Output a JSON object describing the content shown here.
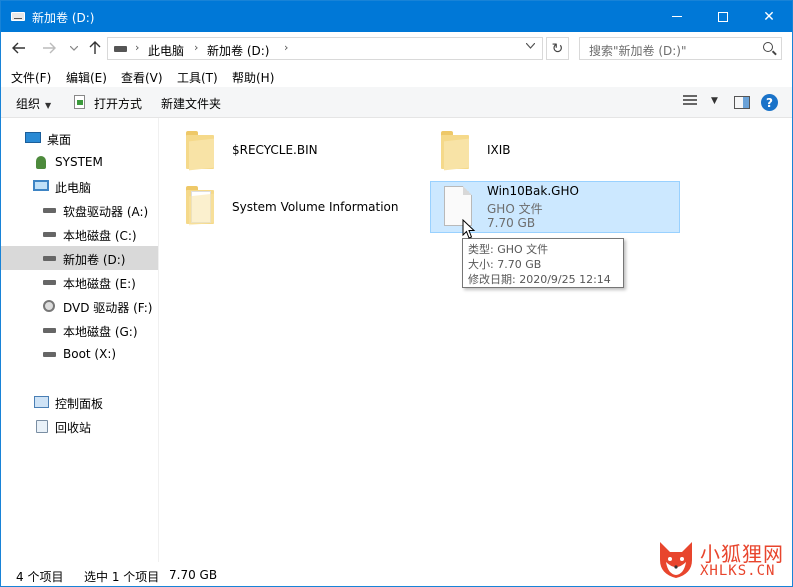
{
  "window": {
    "title": "新加卷 (D:)",
    "accent_color": "#0078d7"
  },
  "titlebar_buttons": {
    "minimize_icon": "minimize-icon",
    "maximize_icon": "maximize-icon",
    "close_glyph": "✕"
  },
  "address_bar": {
    "breadcrumbs": [
      "此电脑",
      "新加卷 (D:)"
    ],
    "separator": "›",
    "refresh_glyph": "↻",
    "search_placeholder": "搜索\"新加卷 (D:)\""
  },
  "menu": [
    "文件(F)",
    "编辑(E)",
    "查看(V)",
    "工具(T)",
    "帮助(H)"
  ],
  "toolbar": {
    "organize": "组织",
    "open_with": "打开方式",
    "new_folder": "新建文件夹",
    "help_glyph": "?"
  },
  "sidebar": {
    "items": [
      {
        "label": "桌面",
        "icon": "desktop-icon"
      },
      {
        "label": "SYSTEM",
        "icon": "user-icon"
      },
      {
        "label": "此电脑",
        "icon": "computer-icon"
      },
      {
        "label": "软盘驱动器 (A:)",
        "icon": "floppy-drive-icon"
      },
      {
        "label": "本地磁盘 (C:)",
        "icon": "drive-icon"
      },
      {
        "label": "新加卷 (D:)",
        "icon": "drive-icon",
        "selected": true
      },
      {
        "label": "本地磁盘 (E:)",
        "icon": "drive-icon"
      },
      {
        "label": "DVD 驱动器 (F:)",
        "icon": "dvd-icon"
      },
      {
        "label": "本地磁盘 (G:)",
        "icon": "drive-icon"
      },
      {
        "label": "Boot (X:)",
        "icon": "drive-icon"
      },
      {
        "label": "控制面板",
        "icon": "control-panel-icon"
      },
      {
        "label": "回收站",
        "icon": "recycle-bin-icon"
      }
    ]
  },
  "files": [
    {
      "name": "$RECYCLE.BIN",
      "type": "folder"
    },
    {
      "name": "IXIB",
      "type": "folder"
    },
    {
      "name": "System Volume Information",
      "type": "folder"
    },
    {
      "name": "Win10Bak.GHO",
      "type": "file",
      "type_label": "GHO 文件",
      "size": "7.70 GB",
      "selected": true
    }
  ],
  "tooltip": {
    "type_line": "类型: GHO 文件",
    "size_line": "大小: 7.70 GB",
    "modified_line": "修改日期: 2020/9/25 12:14"
  },
  "status": {
    "item_count": "4 个项目",
    "selection": "选中 1 个项目",
    "selection_size": "7.70 GB"
  },
  "watermark": {
    "title": "小狐狸网",
    "subtitle": "XHLKS.CN"
  }
}
